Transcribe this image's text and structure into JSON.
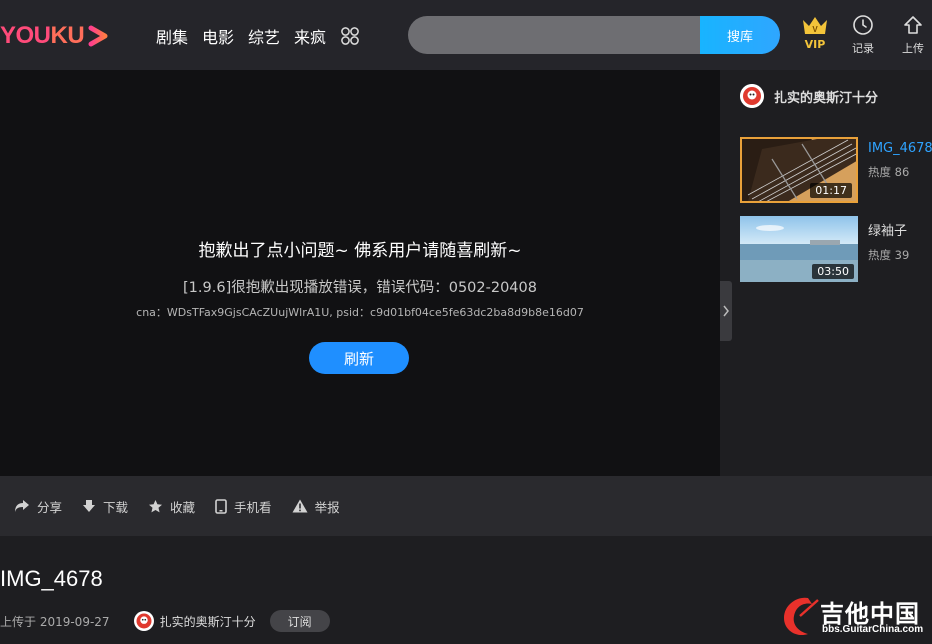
{
  "header": {
    "logo_left": "YOU",
    "logo_right": "KU",
    "nav": [
      "剧集",
      "电影",
      "综艺",
      "来疯"
    ],
    "search_placeholder": "",
    "search_button": "搜库",
    "vip_label": "VIP",
    "history_label": "记录",
    "upload_label": "上传"
  },
  "player": {
    "error_title": "抱歉出了点小问题~ 佛系用户请随喜刷新~",
    "error_message": "[1.9.6]很抱歉出现播放错误，错误代码：0502-20408",
    "error_code_detail": "cna：WDsTFax9GjsCAcZUujWlrA1U, psid：c9d01bf04ce5fe63dc2ba8d9b8e16d07",
    "refresh_button": "刷新"
  },
  "sidebar": {
    "owner_name": "扎实的奥斯汀十分",
    "recommendations": [
      {
        "title": "IMG_4678",
        "heat": "热度 86",
        "duration": "01:17",
        "active": true
      },
      {
        "title": "绿袖子",
        "heat": "热度 39",
        "duration": "03:50",
        "active": false
      }
    ]
  },
  "actions": {
    "share": "分享",
    "download": "下载",
    "favorite": "收藏",
    "mobile": "手机看",
    "report": "举报"
  },
  "video": {
    "title": "IMG_4678",
    "upload_date": "上传于 2019-09-27",
    "owner_name": "扎实的奥斯汀十分",
    "subscribe_button": "订阅"
  },
  "watermark": {
    "main": "吉他中国",
    "sub": "bbs.GuitarChina.com"
  },
  "colors": {
    "accent": "#1f8fff",
    "logo_pink": "#ff4b7a",
    "vip_gold": "#f3c43a",
    "active_title": "#2fa3ff"
  }
}
